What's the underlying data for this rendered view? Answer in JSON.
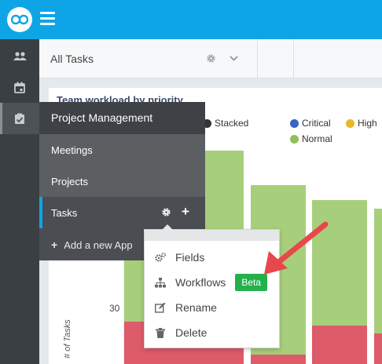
{
  "header": {
    "title": "All Tasks"
  },
  "rail": {
    "items": [
      "team-icon",
      "calendar-icon",
      "checklist-icon"
    ]
  },
  "chart": {
    "title": "Team workload by priority",
    "stacked_label": "Stacked",
    "ylabel": "# of Tasks",
    "ytick_30": "30",
    "legend": [
      {
        "label": "Critical",
        "color": "#3a64c4"
      },
      {
        "label": "High",
        "color": "#e8b829"
      },
      {
        "label": "Normal",
        "color": "#8fbf5a"
      }
    ]
  },
  "flyout": {
    "title": "Project Management",
    "items": [
      {
        "label": "Meetings"
      },
      {
        "label": "Projects"
      },
      {
        "label": "Tasks"
      }
    ],
    "add_app": "Add a new App"
  },
  "context_menu": {
    "items": [
      {
        "label": "Fields",
        "icon": "gears-icon"
      },
      {
        "label": "Workflows",
        "icon": "sitemap-icon",
        "badge": "Beta"
      },
      {
        "label": "Rename",
        "icon": "edit-icon"
      },
      {
        "label": "Delete",
        "icon": "trash-icon"
      }
    ]
  },
  "colors": {
    "brand": "#0ea5e6",
    "normal": "#a7cf7b",
    "critical_bar": "#de5b6a",
    "beta": "#22b14c",
    "annotation_arrow": "#e8474b"
  },
  "chart_data": {
    "type": "bar",
    "title": "Team workload by priority",
    "ylabel": "# of Tasks",
    "stacked": true,
    "series": [
      {
        "name": "Critical",
        "values": []
      },
      {
        "name": "High",
        "values": []
      },
      {
        "name": "Normal",
        "values": []
      }
    ],
    "legend_position": "top-right"
  }
}
